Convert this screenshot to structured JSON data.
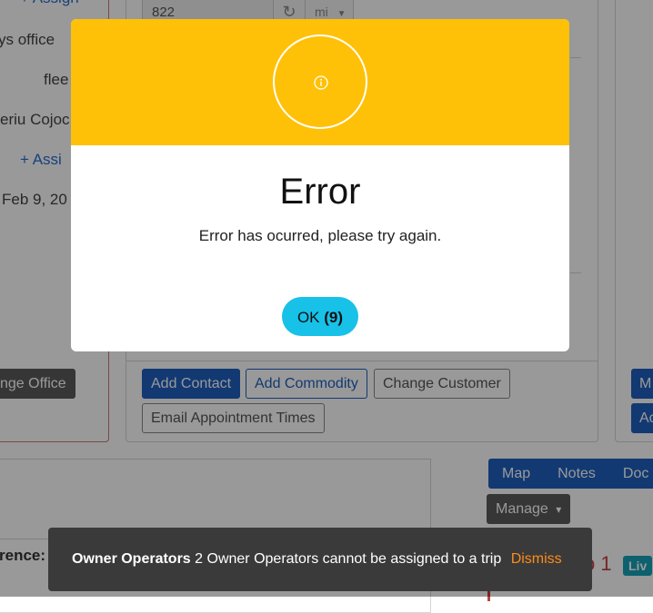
{
  "left_panel": {
    "assign_top": "+ Assign",
    "office_partial": "ys office",
    "fleet_partial": "flee",
    "name_partial": "eriu Cojoc",
    "assign_mid": "+ Assi",
    "date_partial": "Feb 9, 20",
    "change_office_button": "nge Office"
  },
  "top_fields": {
    "distance_value": "822",
    "unit_select": "mi",
    "refresh_icon": "refresh-icon",
    "unit_chevron_icon": "chevron-down-icon"
  },
  "actions": {
    "add_contact": "Add Contact",
    "add_commodity": "Add Commodity",
    "change_customer": "Change Customer",
    "email_appointment_times": "Email Appointment Times"
  },
  "right_panel": {
    "button_1_partial": "M",
    "button_2_partial": "Ac"
  },
  "bottom_left": {
    "reference_label": "rence:"
  },
  "tabs": [
    {
      "label": "Map"
    },
    {
      "label": "Notes"
    },
    {
      "label": "Doc"
    }
  ],
  "manage": {
    "label": "Manage",
    "caret": "▾"
  },
  "stop": {
    "number_partial": "o 1",
    "live_badge": "Liv"
  },
  "modal": {
    "icon": "info-icon",
    "title": "Error",
    "message": "Error has ocurred, please try again.",
    "ok_label": "OK",
    "ok_countdown": "(9)",
    "header_color": "#ffc107",
    "button_color": "#17c1e8"
  },
  "toast": {
    "title": "Owner Operators",
    "message": "2 Owner Operators cannot be assigned to a trip",
    "dismiss": "Dismiss"
  }
}
